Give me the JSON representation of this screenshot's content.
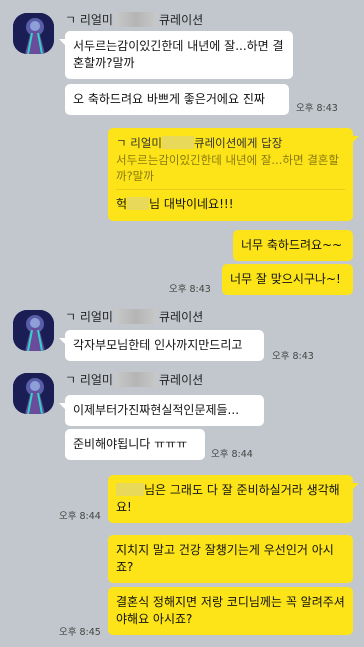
{
  "messages": {
    "name1_a": "ㄱ 리얼미",
    "name1_b": "큐레이션",
    "m1": "서두르는감이있긴한데 내년에 잘...하면 결혼할까?말까",
    "m2": "오 축하드려요 바쁘게 좋은거에요 진짜",
    "t2": "오후 8:43",
    "reply_head_a": "ㄱ 리얼미",
    "reply_head_b": "큐레이션에게 답장",
    "reply_quote": "서두르는감이있긴한데 내년에 잘...하면 결혼할까?말까",
    "reply_a": "헉",
    "reply_b": "님 대박이네요!!!",
    "m4": "너무 축하드려요~~",
    "m5": "너무 잘 맞으시구나~!",
    "t5": "오후 8:43",
    "name2_a": "ㄱ 리얼미",
    "name2_b": "큐레이션",
    "m6": "각자부모님한테 인사까지만드리고",
    "t6": "오후 8:43",
    "name3_a": "ㄱ 리얼미",
    "name3_b": "큐레이션",
    "m7": "이제부터가진짜현실적인문제들...",
    "m8": "준비해야됩니다 ㅠㅠㅠ",
    "t8": "오후 8:44",
    "m9b": "님은 그래도 다 잘 준비하실거라 생각해요!",
    "t9": "오후 8:44",
    "m10": "지치지 말고 건강 잘챙기는게 우선인거 아시죠?",
    "m11": "결혼식 정해지면 저랑 코디님께는 꼭 알려주셔야해요 아시죠?",
    "t11": "오후 8:45"
  }
}
